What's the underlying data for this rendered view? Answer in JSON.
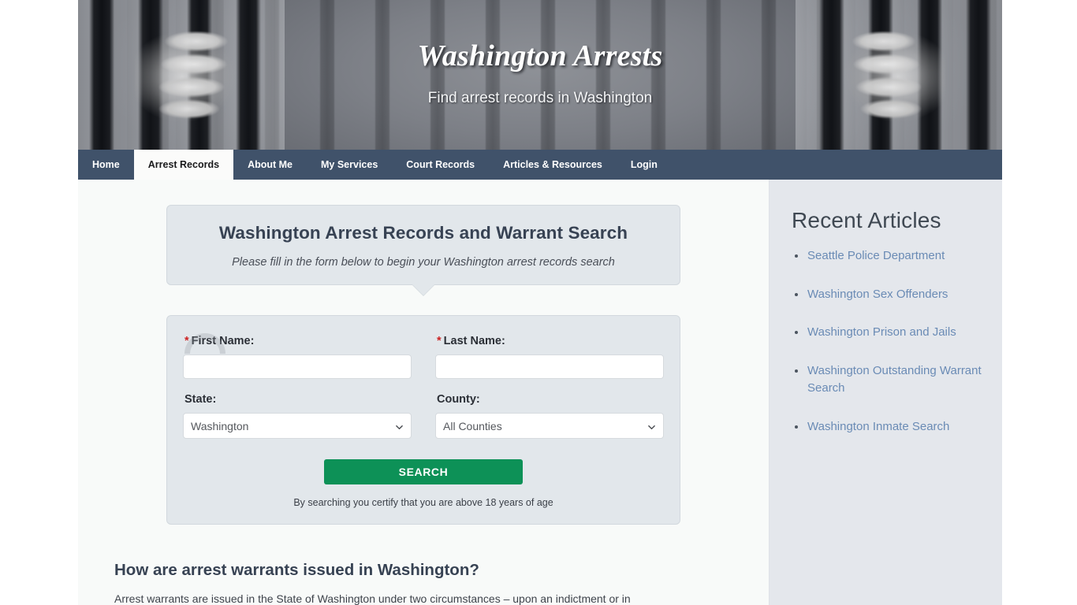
{
  "banner": {
    "title": "Washington Arrests",
    "tagline": "Find arrest records in Washington",
    "left_image_name": "hands-gripping-prison-bars",
    "right_image_name": "hands-gripping-prison-bars"
  },
  "nav": {
    "items": [
      {
        "label": "Home",
        "active": false
      },
      {
        "label": "Arrest Records",
        "active": true
      },
      {
        "label": "About Me",
        "active": false
      },
      {
        "label": "My Services",
        "active": false
      },
      {
        "label": "Court Records",
        "active": false
      },
      {
        "label": "Articles & Resources",
        "active": false
      },
      {
        "label": "Login",
        "active": false
      }
    ]
  },
  "callout": {
    "heading": "Washington Arrest Records and Warrant Search",
    "subheading": "Please fill in the form below to begin your Washington arrest records search"
  },
  "form": {
    "first_name": {
      "label": "First Name:",
      "required_marker": "*",
      "value": "",
      "placeholder": ""
    },
    "last_name": {
      "label": "Last Name:",
      "required_marker": "*",
      "value": "",
      "placeholder": ""
    },
    "state": {
      "label": "State:",
      "selected": "Washington"
    },
    "county": {
      "label": "County:",
      "selected": "All Counties"
    },
    "submit_label": "SEARCH",
    "disclaimer": "By searching you certify that you are above 18 years of age"
  },
  "article": {
    "heading": "How are arrest warrants issued in Washington?",
    "paragraph": "Arrest warrants are issued in the State of Washington under two circumstances – upon an indictment or in"
  },
  "sidebar": {
    "heading": "Recent Articles",
    "links": [
      "Seattle Police Department",
      "Washington Sex Offenders",
      "Washington Prison and Jails",
      "Washington Outstanding Warrant Search",
      "Washington Inmate Search"
    ]
  },
  "colors": {
    "nav_background": "#253a55",
    "nav_active_background": "#fbfbfa",
    "panel_background": "#e2e7eb",
    "sidebar_background": "#e4e7ec",
    "heading_text": "#374253",
    "link_blue": "#6a8bb5",
    "search_button_green": "#0d9157",
    "required_red": "#cc2222"
  }
}
